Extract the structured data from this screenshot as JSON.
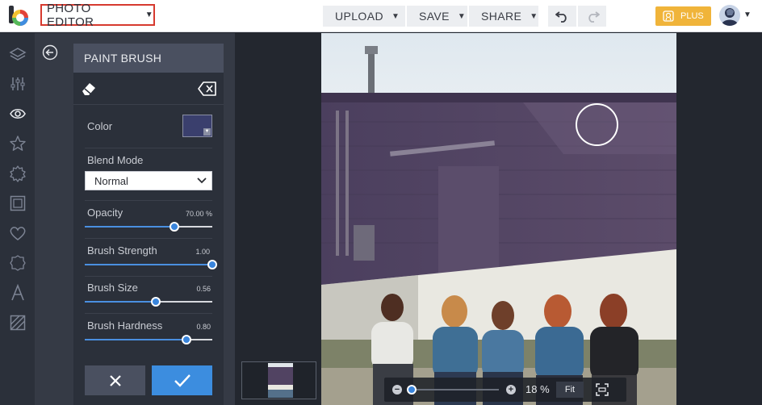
{
  "header": {
    "product_menu_label": "PHOTO EDITOR",
    "upload_label": "UPLOAD",
    "save_label": "SAVE",
    "share_label": "SHARE",
    "plus_label": "PLUS",
    "brand_colors": {
      "accent": "#f0b43a",
      "active_outline": "#d63a2f"
    }
  },
  "rail": {
    "icons": [
      "layers-icon",
      "adjust-icon",
      "eye-icon",
      "star-icon",
      "badge-icon",
      "frame-icon",
      "heart-icon",
      "texture-icon",
      "text-icon",
      "overlay-icon"
    ]
  },
  "panel": {
    "title": "PAINT BRUSH",
    "color_label": "Color",
    "color_value": "#3a3f6d",
    "blend_mode_label": "Blend Mode",
    "blend_mode_value": "Normal",
    "sliders": [
      {
        "label": "Opacity",
        "value_text": "70.00 %",
        "fraction": 0.7
      },
      {
        "label": "Brush Strength",
        "value_text": "1.00",
        "fraction": 1.0
      },
      {
        "label": "Brush Size",
        "value_text": "0.56",
        "fraction": 0.56
      },
      {
        "label": "Brush Hardness",
        "value_text": "0.80",
        "fraction": 0.8
      }
    ],
    "cancel_icon": "close-icon",
    "apply_icon": "check-icon"
  },
  "canvas": {
    "zoom_text": "18 %",
    "zoom_fraction": 0.0,
    "fit_label": "Fit"
  }
}
